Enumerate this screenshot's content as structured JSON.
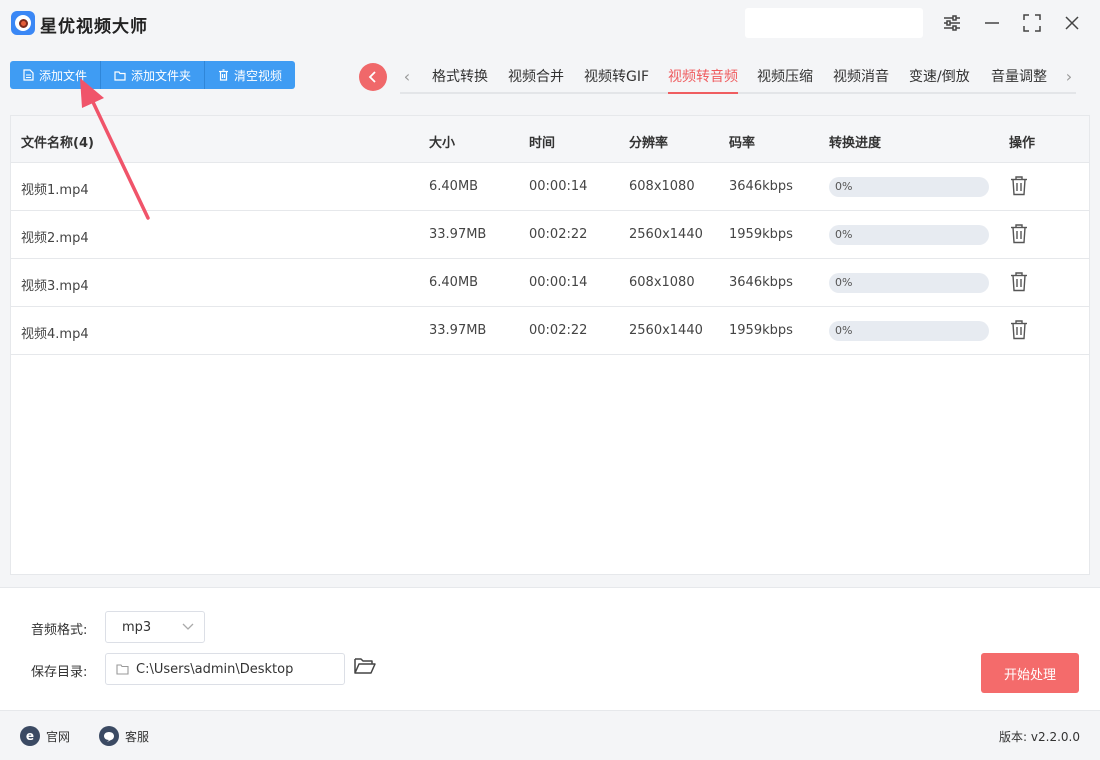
{
  "app": {
    "title": "星优视频大师"
  },
  "toolbar": {
    "add_file": "添加文件",
    "add_folder": "添加文件夹",
    "clear_videos": "清空视频"
  },
  "tabs": [
    {
      "label": "格式转换",
      "active": false
    },
    {
      "label": "视频合并",
      "active": false
    },
    {
      "label": "视频转GIF",
      "active": false
    },
    {
      "label": "视频转音频",
      "active": true
    },
    {
      "label": "视频压缩",
      "active": false
    },
    {
      "label": "视频消音",
      "active": false
    },
    {
      "label": "变速/倒放",
      "active": false
    },
    {
      "label": "音量调整",
      "active": false
    }
  ],
  "table": {
    "headers": {
      "name": "文件名称(4)",
      "size": "大小",
      "time": "时间",
      "resolution": "分辨率",
      "bitrate": "码率",
      "progress": "转换进度",
      "action": "操作"
    },
    "rows": [
      {
        "name": "视频1.mp4",
        "size": "6.40MB",
        "time": "00:00:14",
        "resolution": "608x1080",
        "bitrate": "3646kbps",
        "progress": "0%"
      },
      {
        "name": "视频2.mp4",
        "size": "33.97MB",
        "time": "00:02:22",
        "resolution": "2560x1440",
        "bitrate": "1959kbps",
        "progress": "0%"
      },
      {
        "name": "视频3.mp4",
        "size": "6.40MB",
        "time": "00:00:14",
        "resolution": "608x1080",
        "bitrate": "3646kbps",
        "progress": "0%"
      },
      {
        "name": "视频4.mp4",
        "size": "33.97MB",
        "time": "00:02:22",
        "resolution": "2560x1440",
        "bitrate": "1959kbps",
        "progress": "0%"
      }
    ]
  },
  "settings": {
    "audio_format_label": "音频格式:",
    "audio_format_value": "mp3",
    "save_dir_label": "保存目录:",
    "save_dir_value": "C:\\Users\\admin\\Desktop",
    "start_button": "开始处理"
  },
  "footer": {
    "website": "官网",
    "support": "客服",
    "version_label": "版本:",
    "version_value": "v2.2.0.0"
  },
  "colors": {
    "primary_blue": "#3f9cf3",
    "accent_red": "#ef5d60",
    "start_button": "#f46b6b"
  }
}
